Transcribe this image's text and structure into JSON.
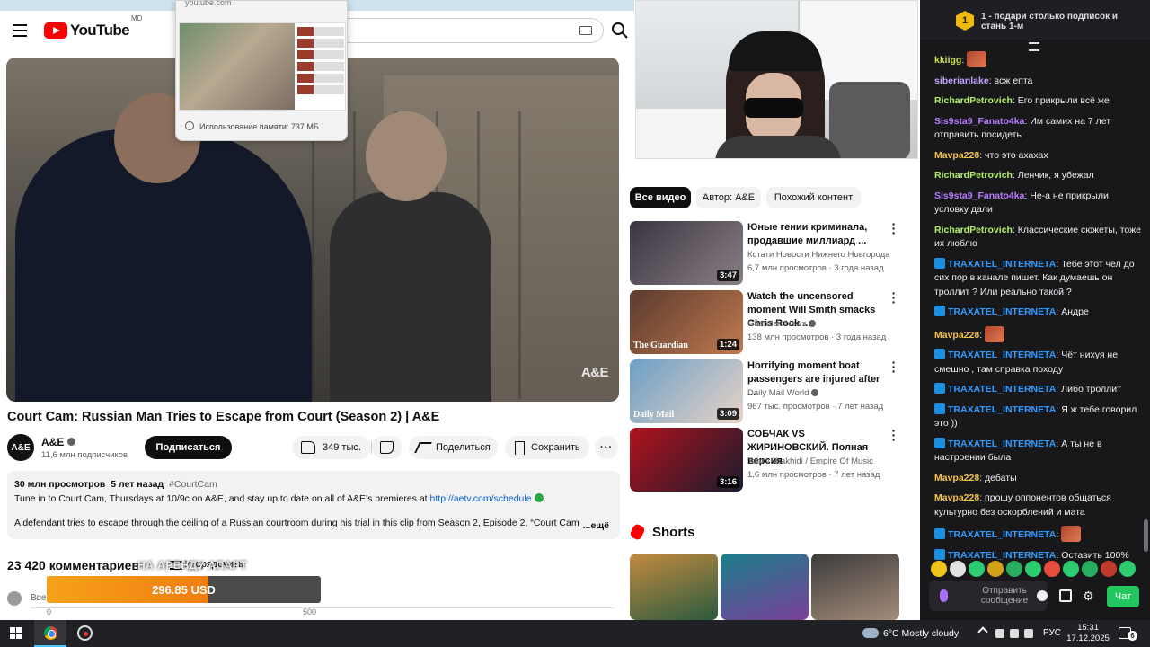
{
  "youtube": {
    "logo_word": "YouTube",
    "logo_region": "MD",
    "tab_preview": {
      "url": "youtube.com",
      "memory": "Использование памяти: 737 МБ"
    },
    "player_watermark": "A&E",
    "video_title": "Court Cam: Russian Man Tries to Escape from Court (Season 2) | A&E",
    "channel": {
      "avatar_text": "A&E",
      "name": "A&E",
      "subscribers": "11,6 млн подписчиков",
      "subscribe_label": "Подписаться"
    },
    "actions": {
      "likes": "349 тыс.",
      "share_label": "Поделиться",
      "save_label": "Сохранить",
      "more_label": "···"
    },
    "description": {
      "views": "30 млн просмотров",
      "age": "5 лет назад",
      "hashtag": "#CourtCam",
      "line1_text": "Tune in to Court Cam, Thursdays at 10/9c on A&E, and stay up to date on all of A&E's premieres at ",
      "line1_link": "http://aetv.com/schedule",
      "line3_text": "A defendant tries to escape through the ceiling of a Russian courtroom during his trial in this clip from Season 2, Episode 2, “Court Cam",
      "more_label": "...ещё"
    },
    "comments": {
      "count_label": "23 420 комментариев",
      "sort_label": "Упорядочить",
      "input_placeholder": "Вве"
    },
    "donation": {
      "overlay_label": "НА АРЕНДУ АПАРТ",
      "amount": "296.85 USD",
      "progress_fraction": 0.59,
      "min_label": "0",
      "max_label": "500"
    },
    "chips": [
      "Все видео",
      "Автор: A&E",
      "Похожий контент"
    ],
    "recommendations": [
      {
        "title": "Юные гении криминала, продавшие миллиард ...",
        "channel": "Кстати Новости Нижнего Новгорода",
        "verified": false,
        "views": "6,7 млн просмотров · 3 года назад",
        "duration": "3:47",
        "thumb_colors": [
          "#3b3540",
          "#8a7f86"
        ]
      },
      {
        "title": "Watch the uncensored moment Will Smith smacks Chris Rock ...",
        "channel": "Guardian News",
        "verified": true,
        "views": "138 млн просмотров · 3 года назад",
        "duration": "1:24",
        "thumb_label": "The Guardian",
        "thumb_colors": [
          "#5b3a2e",
          "#c07a4f"
        ]
      },
      {
        "title": "Horrifying moment boat passengers are injured after ...",
        "channel": "Daily Mail World",
        "verified": true,
        "views": "967 тыс. просмотров · 7 лет назад",
        "duration": "3:09",
        "thumb_label": "Daily Mail",
        "thumb_colors": [
          "#6c9fc5",
          "#e8d3c6"
        ]
      },
      {
        "title": "СОБЧАК VS ЖИРИНОВСКИЙ. Полная версия",
        "channel": "TabrizShakhidi / Empire Of Music",
        "verified": false,
        "views": "1,6 млн просмотров · 7 лет назад",
        "duration": "3:16",
        "thumb_colors": [
          "#b0121c",
          "#1a1c2f"
        ]
      }
    ],
    "shorts_title": "Shorts",
    "shorts_colors": [
      [
        "#c38a3f",
        "#2b5b3f"
      ],
      [
        "#1c7e8a",
        "#7a3f9a"
      ],
      [
        "#3b3b3b",
        "#a58c7a"
      ]
    ]
  },
  "chat": {
    "gift_count": "1",
    "gift_text": "1 - подари столько подписок и стань 1-м",
    "messages": [
      {
        "user": "kkiigg",
        "color": "#c8e04a",
        "badge": false,
        "text": "",
        "emote": true
      },
      {
        "user": "siberianlake",
        "color": "#c4a3ff",
        "badge": false,
        "text": "всж епта",
        "emote": false
      },
      {
        "user": "RichardPetrovich",
        "color": "#b6f06a",
        "badge": false,
        "text": "Его прикрыли всё же",
        "emote": false
      },
      {
        "user": "Sis9sta9_Fanato4ka",
        "color": "#b87cff",
        "badge": false,
        "text": "Им самих на 7 лет отправить посидеть",
        "emote": false
      },
      {
        "user": "Mavpa228",
        "color": "#f5c24a",
        "badge": false,
        "text": "что это ахахах",
        "emote": false
      },
      {
        "user": "RichardPetrovich",
        "color": "#b6f06a",
        "badge": false,
        "text": "Ленчик, я убежал",
        "emote": false
      },
      {
        "user": "Sis9sta9_Fanato4ka",
        "color": "#b87cff",
        "badge": false,
        "text": "Не-а не прикрыли, условку дали",
        "emote": false
      },
      {
        "user": "RichardPetrovich",
        "color": "#b6f06a",
        "badge": false,
        "text": "Классические сюжеты, тоже их люблю",
        "emote": false
      },
      {
        "user": "TRAXATEL_INTERNETA",
        "color": "#2f9bff",
        "badge": true,
        "text": "Тебе этот чел до сих пор в канале пишет. Как думаешь он троллит ? Или реально такой ?",
        "emote": false
      },
      {
        "user": "TRAXATEL_INTERNETA",
        "color": "#2f9bff",
        "badge": true,
        "text": "Андре",
        "emote": false
      },
      {
        "user": "Mavpa228",
        "color": "#f5c24a",
        "badge": false,
        "text": "",
        "emote": true
      },
      {
        "user": "TRAXATEL_INTERNETA",
        "color": "#2f9bff",
        "badge": true,
        "text": "Чёт нихуя не смешно , там справка походу",
        "emote": false
      },
      {
        "user": "TRAXATEL_INTERNETA",
        "color": "#2f9bff",
        "badge": true,
        "text": "Либо троллит",
        "emote": false
      },
      {
        "user": "TRAXATEL_INTERNETA",
        "color": "#2f9bff",
        "badge": true,
        "text": "Я ж тебе говорил это ))",
        "emote": false
      },
      {
        "user": "TRAXATEL_INTERNETA",
        "color": "#2f9bff",
        "badge": true,
        "text": "А ты не в настроении была",
        "emote": false
      },
      {
        "user": "Mavpa228",
        "color": "#f5c24a",
        "badge": false,
        "text": "дебаты",
        "emote": false
      },
      {
        "user": "Mavpa228",
        "color": "#f5c24a",
        "badge": false,
        "text": "прошу оппонентов общаться культурно без оскорблений и мата",
        "emote": false
      },
      {
        "user": "TRAXATEL_INTERNETA",
        "color": "#2f9bff",
        "badge": true,
        "text": "",
        "emote": true
      },
      {
        "user": "TRAXATEL_INTERNETA",
        "color": "#2f9bff",
        "badge": true,
        "text": "Оставить 100%",
        "emote": false
      }
    ],
    "emote_colors": [
      "#f0c419",
      "#e2e2e2",
      "#2ecc71",
      "#d4a017",
      "#27ae60",
      "#2ecc71",
      "#e74c3c",
      "#2ecc71",
      "#27ae60",
      "#c0392b",
      "#2ecc71"
    ],
    "input_placeholder": "Отправить сообщение",
    "send_label": "Чат"
  },
  "taskbar": {
    "weather": "6°C  Mostly cloudy",
    "language": "РУС",
    "time": "15:31",
    "date": "17.12.2025",
    "notification_count": "6"
  }
}
